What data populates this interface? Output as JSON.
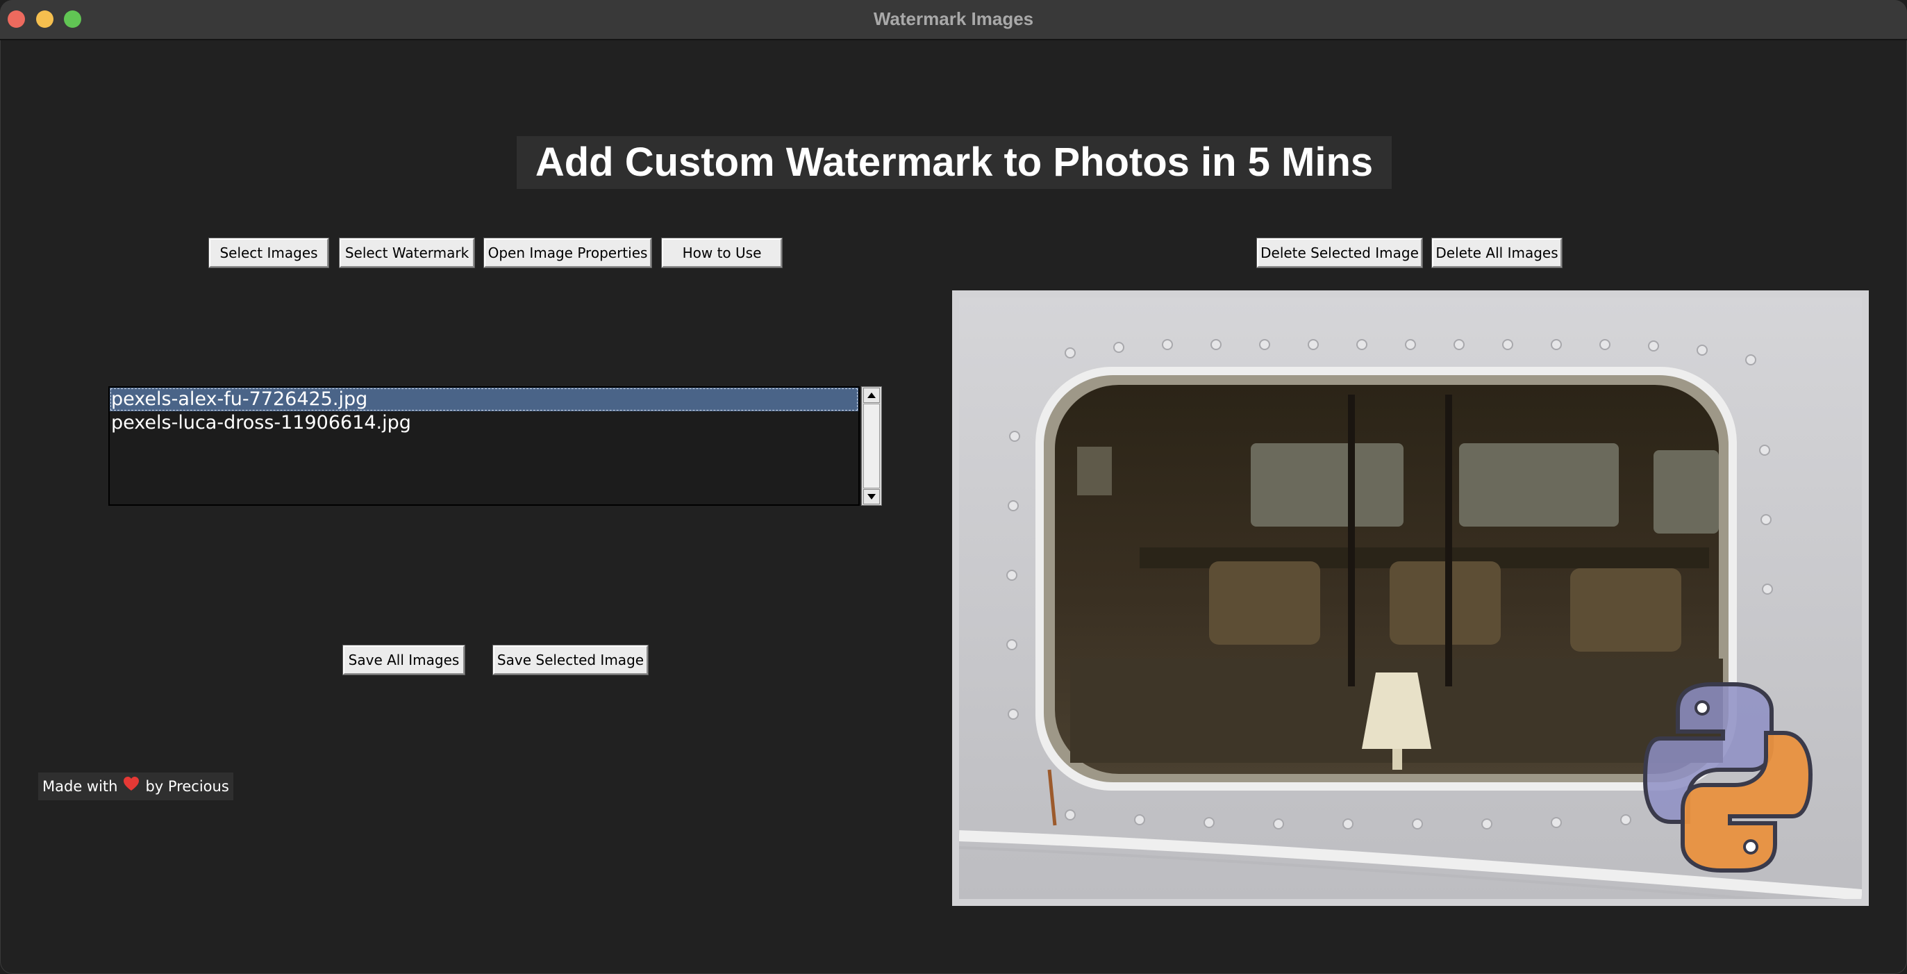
{
  "window": {
    "title": "Watermark Images"
  },
  "headline": "Add Custom Watermark to Photos in 5 Mins",
  "toolbar_left": {
    "select_images": "Select Images",
    "select_watermark": "Select Watermark",
    "open_properties": "Open Image Properties",
    "how_to_use": "How to Use"
  },
  "toolbar_right": {
    "delete_selected": "Delete Selected Image",
    "delete_all": "Delete All Images"
  },
  "files": {
    "items": [
      "pexels-alex-fu-7726425.jpg",
      "pexels-luca-dross-11906614.jpg"
    ],
    "selected_index": 0
  },
  "save": {
    "save_all": "Save All Images",
    "save_selected": "Save Selected Image"
  },
  "credit": {
    "prefix": "Made with",
    "icon": "heart-icon",
    "suffix": "by Precious"
  },
  "preview": {
    "image": "ship-window-photo",
    "watermark": "python-logo-icon"
  },
  "colors": {
    "selection": "#4a6488",
    "background": "#212121",
    "heart": "#e53935"
  }
}
